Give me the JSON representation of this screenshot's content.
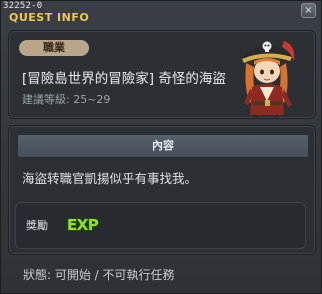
{
  "window": {
    "id_text": "32252-0",
    "title": "QUEST INFO",
    "close_symbol": "×"
  },
  "quest": {
    "job_badge": "職業",
    "name": "[冒險島世界的冒險家] 奇怪的海盜",
    "level_label": "建議等級: 25~29",
    "npc_icon": "pirate-npc-portrait"
  },
  "content": {
    "header": "內容",
    "description": "海盜转職官凱揚似乎有事找我。"
  },
  "reward": {
    "label": "獎勵",
    "exp_text": "EXP",
    "exp_color": "#8ee22a"
  },
  "status": {
    "text": "狀態: 可開始 / 不可執行任務"
  },
  "colors": {
    "title": "#f0c850",
    "badge": "#b9a68a",
    "panel": "#2c3035"
  }
}
